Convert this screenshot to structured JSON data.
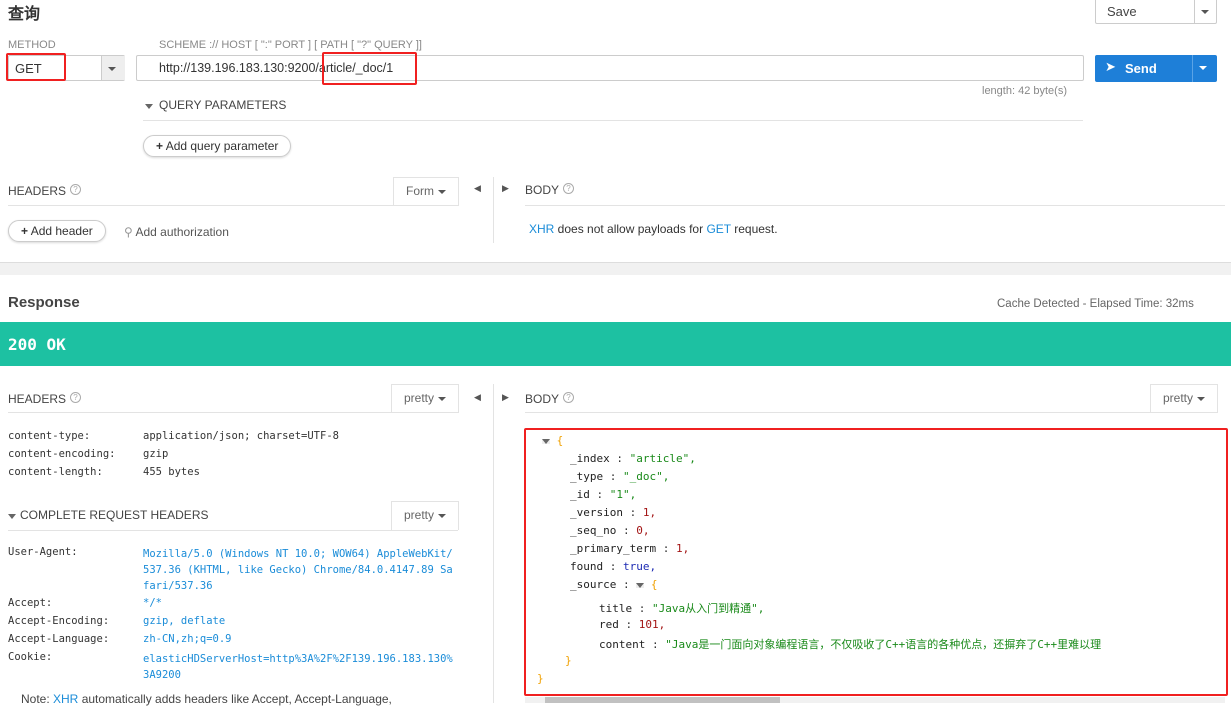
{
  "request": {
    "title": "查询",
    "save_label": "Save",
    "method_label": "METHOD",
    "method": "GET",
    "url_hint": "SCHEME :// HOST [ \":\" PORT ] [ PATH [ \"?\" QUERY ]]",
    "url": "http://139.196.183.130:9200/article/_doc/1",
    "send_label": "Send",
    "length": "length: 42 byte(s)",
    "query_params_label": "QUERY PARAMETERS",
    "add_query_param": "Add query parameter",
    "headers_label": "HEADERS",
    "form_label": "Form",
    "body_label": "BODY",
    "add_header": "Add header",
    "add_authorization": "Add authorization",
    "xhr": "XHR",
    "body_note_mid": " does not allow payloads for ",
    "body_note_get": "GET",
    "body_note_end": " request."
  },
  "response": {
    "title": "Response",
    "cache_info": "Cache Detected - Elapsed Time: 32ms",
    "status": "200 OK",
    "status_color": "#1dc1a2",
    "headers_label": "HEADERS",
    "pretty": "pretty",
    "body_label": "BODY",
    "headers": [
      {
        "key": "content-type:",
        "value": "application/json; charset=UTF-8"
      },
      {
        "key": "content-encoding:",
        "value": "gzip"
      },
      {
        "key": "content-length:",
        "value": "455 bytes"
      }
    ],
    "complete_label": "COMPLETE REQUEST HEADERS",
    "request_headers": [
      {
        "key": "User-Agent:",
        "value": "Mozilla/5.0 (Windows NT 10.0; WOW64) AppleWebKit/537.36 (KHTML, like Gecko) Chrome/84.0.4147.89 Safari/537.36"
      },
      {
        "key": "Accept:",
        "value": "*/*"
      },
      {
        "key": "Accept-Encoding:",
        "value": "gzip, deflate"
      },
      {
        "key": "Accept-Language:",
        "value": "zh-CN,zh;q=0.9"
      },
      {
        "key": "Cookie:",
        "value": "elasticHDServerHost=http%3A%2F%2F139.196.183.130%3A9200"
      }
    ],
    "note_prefix": "Note: ",
    "note_xhr": "XHR",
    "note_rest": " automatically adds headers like Accept, Accept-Language,",
    "json": {
      "_index": "\"article\",",
      "_type": "\"_doc\",",
      "_id": "\"1\",",
      "_version": "1,",
      "_seq_no": "0,",
      "_primary_term": "1,",
      "found": "true,",
      "title": "\"Java从入门到精通\",",
      "red": "101,",
      "content": "\"Java是一门面向对象编程语言，不仅吸收了C++语言的各种优点，还摒弃了C++里难以理"
    }
  }
}
